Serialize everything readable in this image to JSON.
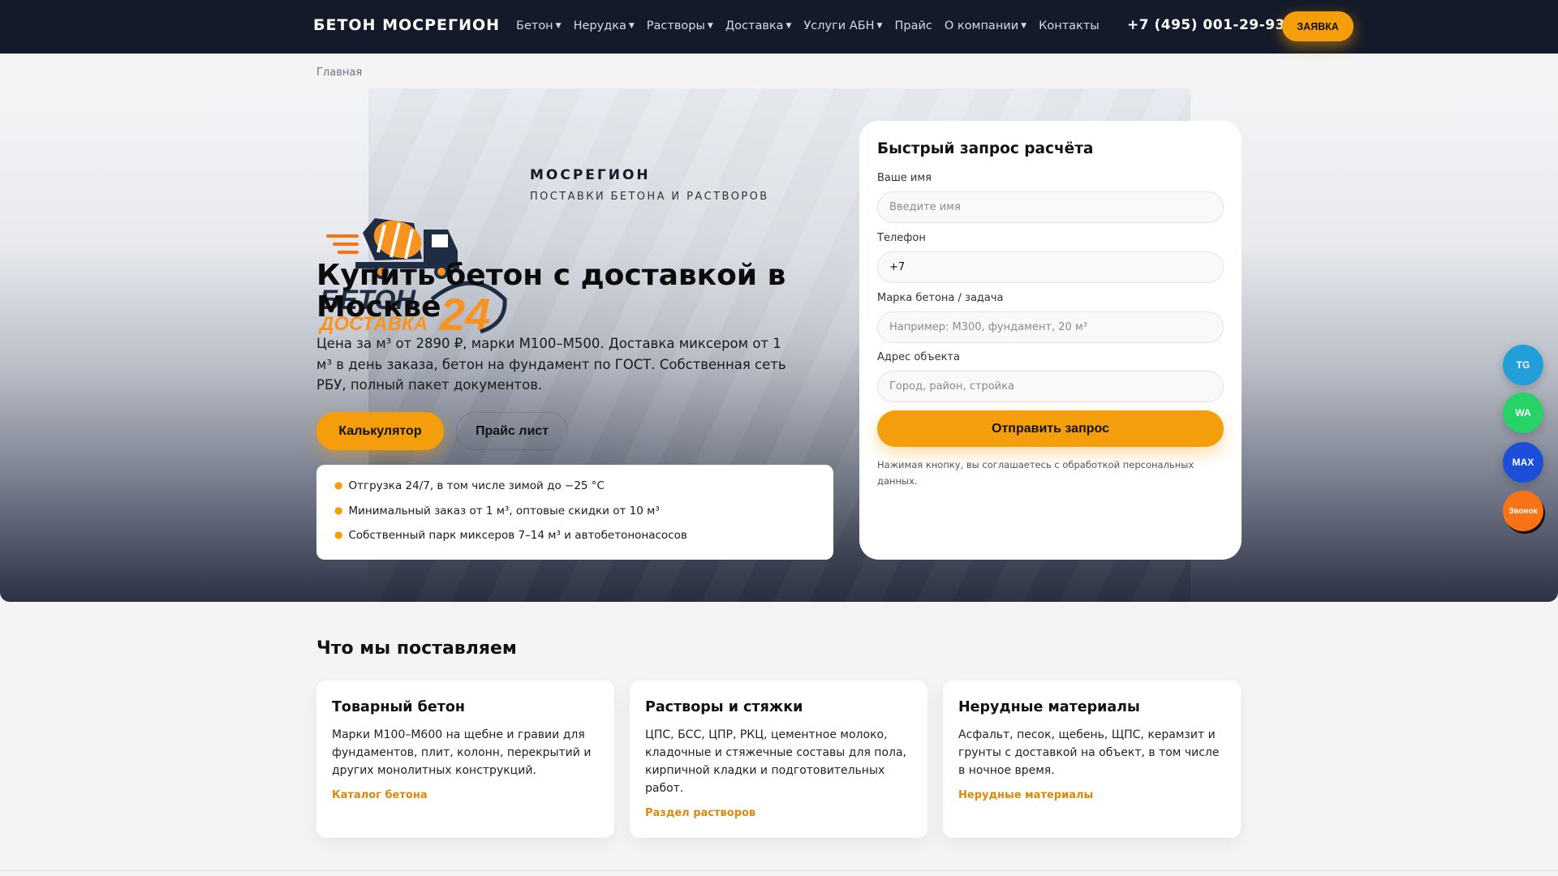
{
  "nav": {
    "brand": "БЕТОН МОСРЕГИОН",
    "items": [
      {
        "label": "Бетон",
        "dropdown": true
      },
      {
        "label": "Нерудка",
        "dropdown": true
      },
      {
        "label": "Растворы",
        "dropdown": true
      },
      {
        "label": "Доставка",
        "dropdown": true
      },
      {
        "label": "Услуги АБН",
        "dropdown": true
      },
      {
        "label": "Прайс",
        "dropdown": false
      },
      {
        "label": "О компании",
        "dropdown": true
      },
      {
        "label": "Контакты",
        "dropdown": false
      }
    ],
    "phone": "+7 (495) 001-29-93",
    "cta": "ЗАЯВКА"
  },
  "breadcrumb": [
    "Главная"
  ],
  "hero": {
    "logo_text": [
      "БЕТОН",
      "ДОСТАВКА",
      "24"
    ],
    "tagline": "МОСРЕГИОН",
    "subtagline": "ПОСТАВКИ БЕТОНА И РАСТВОРОВ",
    "title": "Купить бетон с доставкой в Москве",
    "lead": "Цена за м³ от 2890 ₽, марки М100–М500. Доставка миксером от 1 м³ в день заказа, бетон на фундамент по ГОСТ. Собственная сеть РБУ, полный пакет документов.",
    "btn_calc": "Калькулятор",
    "btn_price": "Прайс лист",
    "features": [
      "Отгрузка 24/7, в том числе зимой до −25 °С",
      "Минимальный заказ от 1 м³, оптовые скидки от 10 м³",
      "Собственный парк миксеров 7–14 м³ и автобетононасосов"
    ]
  },
  "form": {
    "title": "Быстрый запрос расчёта",
    "fields": [
      {
        "label": "Ваше имя",
        "placeholder": "Введите имя",
        "value": ""
      },
      {
        "label": "Телефон",
        "placeholder": "",
        "value": "+7"
      },
      {
        "label": "Марка бетона / задача",
        "placeholder": "Например: М300, фундамент, 20 м³",
        "value": ""
      },
      {
        "label": "Адрес объекта",
        "placeholder": "Город, район, стройка",
        "value": ""
      }
    ],
    "submit": "Отправить запрос",
    "note": "Нажимая кнопку, вы соглашаетесь с обработкой персональных данных."
  },
  "side": [
    {
      "label": "TG",
      "color": "#229ed9"
    },
    {
      "label": "WA",
      "color": "#25d366"
    },
    {
      "label": "MAX",
      "color": "#1d4ed8"
    },
    {
      "label": "Звонок",
      "color": "#f97316"
    }
  ],
  "section": {
    "title": "Что мы поставляем",
    "cards": [
      {
        "title": "Товарный бетон",
        "text": "Марки М100–М600 на щебне и гравии для фундаментов, плит, колонн, перекрытий и других монолитных конструкций.",
        "link": "Каталог бетона"
      },
      {
        "title": "Растворы и стяжки",
        "text": "ЦПС, БСС, ЦПР, РКЦ, цементное молоко, кладочные и стяжечные составы для пола, кирпичной кладки и подготовительных работ.",
        "link": "Раздел растворов"
      },
      {
        "title": "Нерудные материалы",
        "text": "Асфальт, песок, щебень, ЩПС, керамзит и грунты с доставкой на объект, в том числе в ночное время.",
        "link": "Нерудные материалы"
      }
    ]
  }
}
